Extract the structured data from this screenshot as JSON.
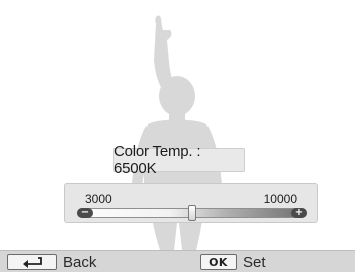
{
  "overlay": {
    "color_temp_label": "Color Temp. : 6500K"
  },
  "slider": {
    "min_label": "3000",
    "max_label": "10000",
    "min_value": 3000,
    "max_value": 10000,
    "current_value": 6500,
    "minus_symbol": "−",
    "plus_symbol": "+"
  },
  "bottom_bar": {
    "back_label": "Back",
    "back_icon": "return-arrow-icon",
    "ok_key_label": "OK",
    "set_label": "Set"
  },
  "colors": {
    "background": "#ffffff",
    "silhouette": "#d9d9d9",
    "bar": "#d6d6d6"
  }
}
